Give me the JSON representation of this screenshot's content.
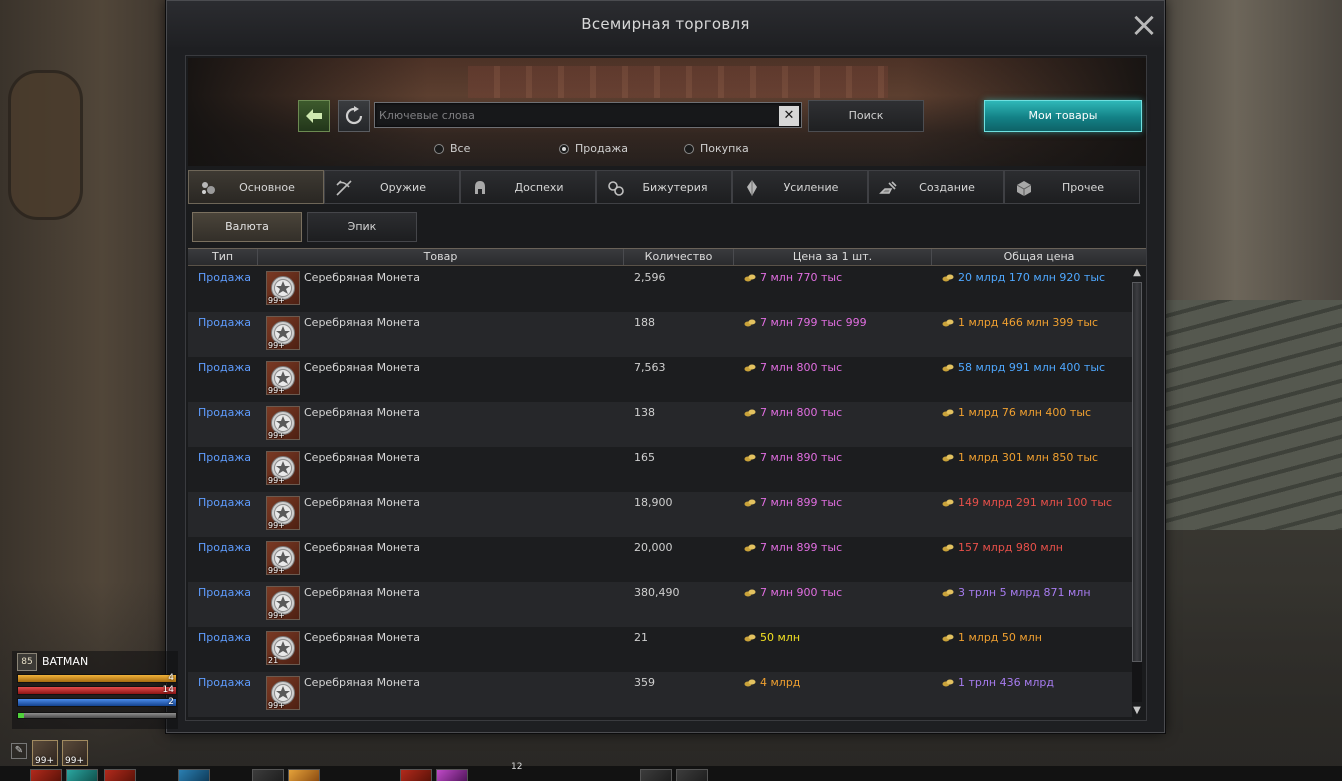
{
  "window": {
    "title": "Всемирная торговля"
  },
  "search": {
    "placeholder": "Ключевые слова",
    "value": "",
    "button_label": "Поиск",
    "my_goods_label": "Мои товары"
  },
  "filters": [
    {
      "label": "Все",
      "selected": false
    },
    {
      "label": "Продажа",
      "selected": true
    },
    {
      "label": "Покупка",
      "selected": false
    }
  ],
  "categories": [
    {
      "label": "Основное",
      "icon": "basic-icon",
      "active": true
    },
    {
      "label": "Оружие",
      "icon": "crossbow-icon",
      "active": false
    },
    {
      "label": "Доспехи",
      "icon": "helmet-icon",
      "active": false
    },
    {
      "label": "Бижутерия",
      "icon": "jewelry-icon",
      "active": false
    },
    {
      "label": "Усиление",
      "icon": "gem-icon",
      "active": false
    },
    {
      "label": "Создание",
      "icon": "craft-icon",
      "active": false
    },
    {
      "label": "Прочее",
      "icon": "box-icon",
      "active": false
    }
  ],
  "subtabs": [
    {
      "label": "Валюта",
      "active": true
    },
    {
      "label": "Эпик",
      "active": false
    }
  ],
  "table": {
    "headers": {
      "type": "Тип",
      "item": "Товар",
      "qty": "Количество",
      "price": "Цена за 1 шт.",
      "total": "Общая цена"
    },
    "rows": [
      {
        "type": "Продажа",
        "item": "Серебряная Монета",
        "stack": "99+",
        "qty": "2,596",
        "price": "7 млн 770 тыс",
        "total": "20 млрд 170 млн 920 тыс",
        "price_color": "#e06ee0",
        "total_color": "#4fa8ff"
      },
      {
        "type": "Продажа",
        "item": "Серебряная Монета",
        "stack": "99+",
        "qty": "188",
        "price": "7 млн 799 тыс 999",
        "total": "1 млрд 466 млн 399 тыс",
        "price_color": "#e06ee0",
        "total_color": "#f0a030"
      },
      {
        "type": "Продажа",
        "item": "Серебряная Монета",
        "stack": "99+",
        "qty": "7,563",
        "price": "7 млн 800 тыс",
        "total": "58 млрд 991 млн 400 тыс",
        "price_color": "#e06ee0",
        "total_color": "#4fa8ff"
      },
      {
        "type": "Продажа",
        "item": "Серебряная Монета",
        "stack": "99+",
        "qty": "138",
        "price": "7 млн 800 тыс",
        "total": "1 млрд 76 млн 400 тыс",
        "price_color": "#e06ee0",
        "total_color": "#f0a030"
      },
      {
        "type": "Продажа",
        "item": "Серебряная Монета",
        "stack": "99+",
        "qty": "165",
        "price": "7 млн 890 тыс",
        "total": "1 млрд 301 млн 850 тыс",
        "price_color": "#e06ee0",
        "total_color": "#f0a030"
      },
      {
        "type": "Продажа",
        "item": "Серебряная Монета",
        "stack": "99+",
        "qty": "18,900",
        "price": "7 млн 899 тыс",
        "total": "149 млрд 291 млн 100 тыс",
        "price_color": "#e06ee0",
        "total_color": "#e8504a"
      },
      {
        "type": "Продажа",
        "item": "Серебряная Монета",
        "stack": "99+",
        "qty": "20,000",
        "price": "7 млн 899 тыс",
        "total": "157 млрд 980 млн",
        "price_color": "#e06ee0",
        "total_color": "#e8504a"
      },
      {
        "type": "Продажа",
        "item": "Серебряная Монета",
        "stack": "99+",
        "qty": "380,490",
        "price": "7 млн 900 тыс",
        "total": "3 трлн 5 млрд 871 млн",
        "price_color": "#e06ee0",
        "total_color": "#a77cf0"
      },
      {
        "type": "Продажа",
        "item": "Серебряная Монета",
        "stack": "21",
        "qty": "21",
        "price": "50 млн",
        "total": "1 млрд 50 млн",
        "price_color": "#f2e022",
        "total_color": "#f0a030"
      },
      {
        "type": "Продажа",
        "item": "Серебряная Монета",
        "stack": "99+",
        "qty": "359",
        "price": "4 млрд",
        "total": "1 трлн 436 млрд",
        "price_color": "#f0a030",
        "total_color": "#a77cf0"
      }
    ]
  },
  "player": {
    "name": "BATMAN",
    "level": "85",
    "cp_text": "4",
    "hp_text": "14",
    "mp_text": "2",
    "xp_fraction": 0.04
  },
  "hud": {
    "buff_counts": [
      "99+",
      "99+"
    ],
    "hotbar_page": "12"
  }
}
